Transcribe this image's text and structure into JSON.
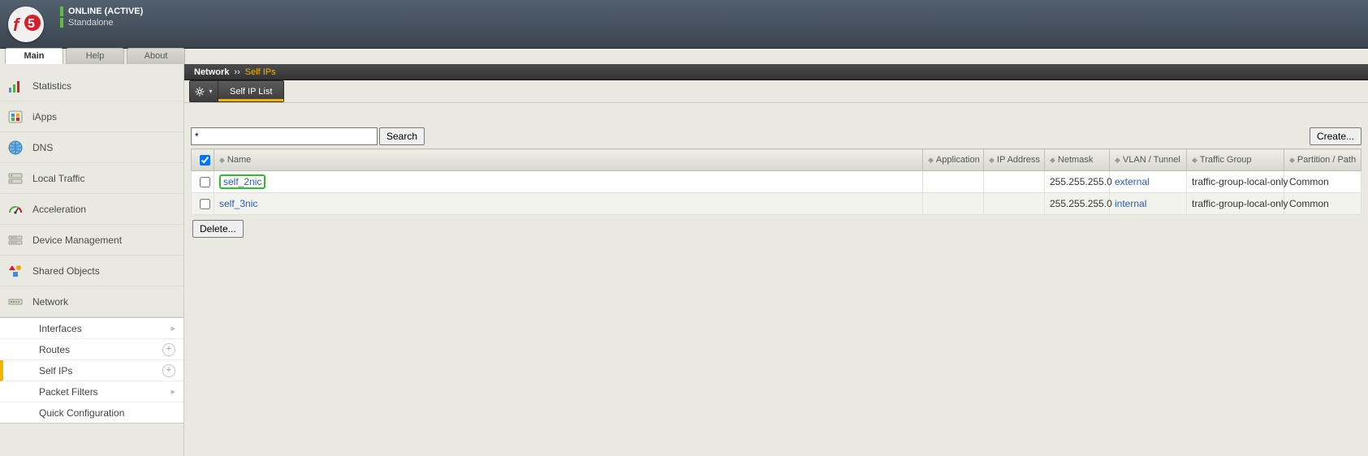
{
  "header": {
    "status_text": "ONLINE (ACTIVE)",
    "status_sub": "Standalone"
  },
  "toptabs": {
    "main": "Main",
    "help": "Help",
    "about": "About"
  },
  "sidebar": {
    "statistics": "Statistics",
    "iapps": "iApps",
    "dns": "DNS",
    "local_traffic": "Local Traffic",
    "acceleration": "Acceleration",
    "device_mgmt": "Device Management",
    "shared_objects": "Shared Objects",
    "network": "Network",
    "sub": {
      "interfaces": "Interfaces",
      "routes": "Routes",
      "self_ips": "Self IPs",
      "packet_filters": "Packet Filters",
      "quick_config": "Quick Configuration"
    }
  },
  "breadcrumb": {
    "root": "Network",
    "current": "Self IPs"
  },
  "subnav": {
    "tab": "Self IP List"
  },
  "search": {
    "value": "*",
    "search_btn": "Search",
    "create_btn": "Create..."
  },
  "table": {
    "headers": {
      "name": "Name",
      "application": "Application",
      "ip": "IP Address",
      "netmask": "Netmask",
      "vlan": "VLAN / Tunnel",
      "traffic_group": "Traffic Group",
      "partition": "Partition / Path"
    },
    "rows": [
      {
        "name": "self_2nic",
        "application": "",
        "ip": "",
        "netmask": "255.255.255.0",
        "vlan": "external",
        "traffic_group": "traffic-group-local-only",
        "partition": "Common",
        "highlight": true
      },
      {
        "name": "self_3nic",
        "application": "",
        "ip": "",
        "netmask": "255.255.255.0",
        "vlan": "internal",
        "traffic_group": "traffic-group-local-only",
        "partition": "Common",
        "highlight": false
      }
    ]
  },
  "buttons": {
    "delete": "Delete..."
  }
}
